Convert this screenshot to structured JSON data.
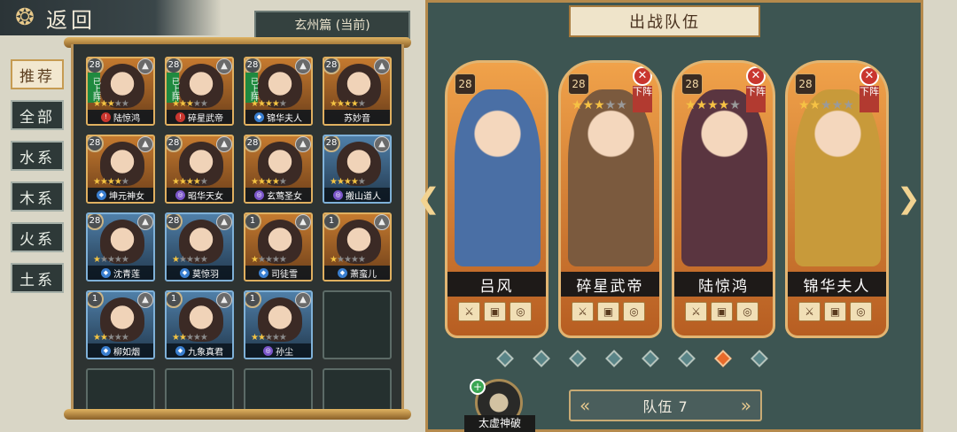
{
  "header": {
    "back_label": "返回",
    "back_icon": "cloud-swirl-icon",
    "chapter_tag": "玄州篇 (当前)"
  },
  "tabs": [
    {
      "label": "推荐",
      "active": true
    },
    {
      "label": "全部",
      "active": false
    },
    {
      "label": "水系",
      "active": false
    },
    {
      "label": "木系",
      "active": false
    },
    {
      "label": "火系",
      "active": false
    },
    {
      "label": "土系",
      "active": false
    }
  ],
  "roster": [
    {
      "level": "28",
      "name": "陆惊鸿",
      "stars": 3,
      "deployed": true,
      "deployed_label": "已上阵",
      "style": "gold",
      "elem_color": "#c9362f",
      "elem": "!"
    },
    {
      "level": "28",
      "name": "碎星武帝",
      "stars": 3,
      "deployed": true,
      "deployed_label": "已上阵",
      "style": "gold",
      "elem_color": "#c9362f",
      "elem": "!"
    },
    {
      "level": "28",
      "name": "锦华夫人",
      "stars": 4,
      "deployed": true,
      "deployed_label": "已上阵",
      "style": "gold",
      "elem_color": "#3a7fd0",
      "elem": "◆"
    },
    {
      "level": "28",
      "name": "苏妙音",
      "stars": 4,
      "deployed": false,
      "style": "gold",
      "elem_color": "",
      "elem": ""
    },
    {
      "level": "28",
      "name": "坤元神女",
      "stars": 4,
      "deployed": false,
      "style": "gold",
      "elem_color": "#3a7fd0",
      "elem": "◆"
    },
    {
      "level": "28",
      "name": "昭华天女",
      "stars": 4,
      "deployed": false,
      "style": "gold",
      "elem_color": "#7a55c9",
      "elem": "◎"
    },
    {
      "level": "28",
      "name": "玄莺圣女",
      "stars": 4,
      "deployed": false,
      "style": "gold",
      "elem_color": "#7a55c9",
      "elem": "◎"
    },
    {
      "level": "28",
      "name": "搬山道人",
      "stars": 4,
      "deployed": false,
      "style": "blue",
      "elem_color": "#7a55c9",
      "elem": "◎"
    },
    {
      "level": "28",
      "name": "沈青莲",
      "stars": 1,
      "deployed": false,
      "style": "blue",
      "elem_color": "#3a7fd0",
      "elem": "◆"
    },
    {
      "level": "28",
      "name": "莫惊羽",
      "stars": 1,
      "deployed": false,
      "style": "blue",
      "elem_color": "#3a7fd0",
      "elem": "◆"
    },
    {
      "level": "1",
      "name": "司徒雪",
      "stars": 1,
      "deployed": false,
      "style": "gold",
      "elem_color": "#3a7fd0",
      "elem": "◆"
    },
    {
      "level": "1",
      "name": "萧蛮儿",
      "stars": 1,
      "deployed": false,
      "style": "gold",
      "elem_color": "#3a7fd0",
      "elem": "◆"
    },
    {
      "level": "1",
      "name": "柳如烟",
      "stars": 2,
      "deployed": false,
      "style": "blue",
      "elem_color": "#3a7fd0",
      "elem": "◆"
    },
    {
      "level": "1",
      "name": "九象真君",
      "stars": 2,
      "deployed": false,
      "style": "blue",
      "elem_color": "#3a7fd0",
      "elem": "◆"
    },
    {
      "level": "1",
      "name": "孙尘",
      "stars": 2,
      "deployed": false,
      "style": "blue",
      "elem_color": "#7a55c9",
      "elem": "◎"
    }
  ],
  "team": {
    "title": "出战队伍",
    "heroes": [
      {
        "name": "吕风",
        "level": "28",
        "stars": 0,
        "removable": false,
        "art": "#4a6fa5"
      },
      {
        "name": "碎星武帝",
        "level": "28",
        "stars": 3,
        "removable": true,
        "unequip_label": "下阵",
        "art": "#7b5a3e"
      },
      {
        "name": "陆惊鸿",
        "level": "28",
        "stars": 4,
        "removable": true,
        "unequip_label": "下阵",
        "art": "#5a3540"
      },
      {
        "name": "锦华夫人",
        "level": "28",
        "stars": 2,
        "removable": true,
        "unequip_label": "下阵",
        "art": "#c89a3a"
      }
    ],
    "page_dots": 8,
    "active_dot": 6,
    "skill_label": "太虚神破",
    "selector_label": "队伍 7"
  }
}
